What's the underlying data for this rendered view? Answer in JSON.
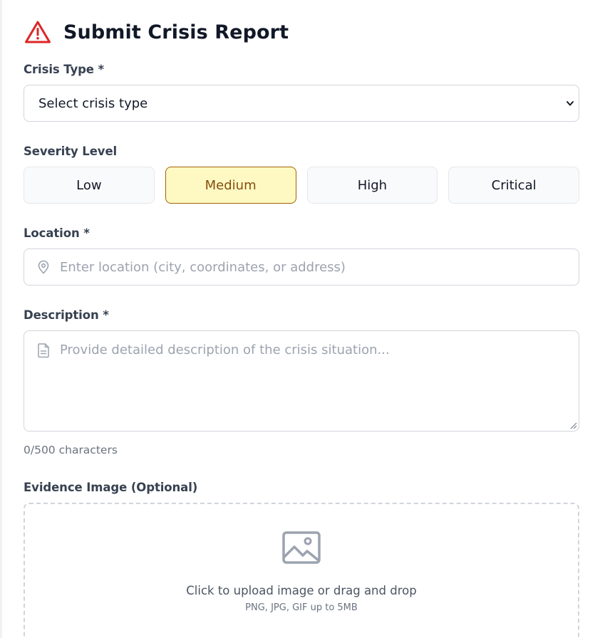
{
  "form": {
    "title": "Submit Crisis Report",
    "crisis_type": {
      "label": "Crisis Type *",
      "selected": "Select crisis type"
    },
    "severity": {
      "label": "Severity Level",
      "options": [
        "Low",
        "Medium",
        "High",
        "Critical"
      ],
      "selected": "Medium"
    },
    "location": {
      "label": "Location *",
      "value": "",
      "placeholder": "Enter location (city, coordinates, or address)"
    },
    "description": {
      "label": "Description *",
      "value": "",
      "placeholder": "Provide detailed description of the crisis situation...",
      "char_count": "0/500 characters"
    },
    "evidence": {
      "label": "Evidence Image (Optional)",
      "upload_text": "Click to upload image or drag and drop",
      "upload_hint": "PNG, JPG, GIF up to 5MB"
    }
  },
  "icons": {
    "header": "warning-triangle-icon",
    "location": "map-pin-icon",
    "description": "document-icon",
    "upload": "image-icon",
    "select": "chevron-down-icon"
  },
  "colors": {
    "warning_icon": "#dc2626",
    "selected_bg": "#fef9c3",
    "selected_border": "#a16207",
    "selected_text": "#854d0e"
  }
}
